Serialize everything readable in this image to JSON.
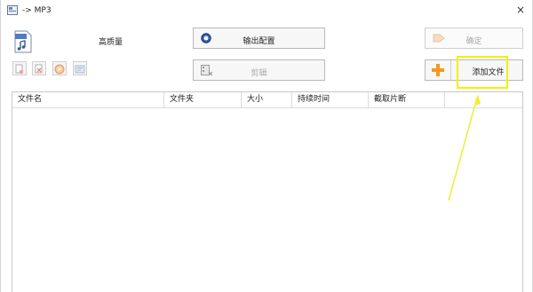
{
  "window": {
    "title": "-> MP3",
    "close_glyph": "×"
  },
  "quality": {
    "label": "高质量",
    "icon": "mp3-file-icon"
  },
  "buttons": {
    "output_config": {
      "label": "输出配置",
      "icon": "output-config-icon"
    },
    "cut": {
      "label": "剪辑",
      "icon": "cut-film-icon"
    },
    "ok": {
      "label": "确定",
      "icon": "confirm-icon"
    },
    "add_file": {
      "label": "添加文件",
      "icon": "plus-icon"
    }
  },
  "toolbar": {
    "items": [
      "remove-file-icon",
      "clear-list-icon",
      "play-icon",
      "info-icon"
    ]
  },
  "table": {
    "columns": [
      "文件名",
      "文件夹",
      "大小",
      "持续时间",
      "截取片断",
      ""
    ]
  },
  "colors": {
    "highlight": "#f4f000",
    "arrow": "#f0ee3a",
    "plus": "#f39a1d"
  }
}
